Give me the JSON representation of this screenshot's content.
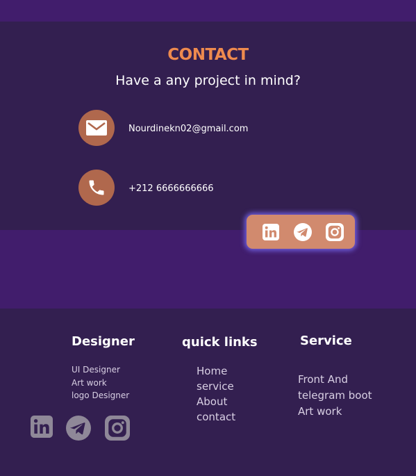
{
  "contact": {
    "title": "CONTACT",
    "subtitle": "Have a any project in  mind?",
    "email": "Nourdinekn02@gmail.com",
    "phone": "+212 6666666666",
    "icons": [
      "mail-icon",
      "phone-icon"
    ],
    "social_icons": [
      "linkedin-icon",
      "telegram-icon",
      "instagram-icon"
    ]
  },
  "footer": {
    "designer": {
      "heading": "Designer",
      "items": [
        "UI Designer",
        "Art work",
        "logo Designer"
      ]
    },
    "quick_links": {
      "heading": "quick links",
      "items": [
        "Home",
        "service",
        "About",
        "contact"
      ]
    },
    "service": {
      "heading": "Service",
      "items": [
        "Front And",
        "telegram boot",
        "Art work"
      ]
    },
    "social_icons": [
      "linkedin-icon",
      "telegram-icon",
      "instagram-icon"
    ]
  },
  "colors": {
    "accent": "#ee8a4e",
    "icon_bg": "#b0684d",
    "pill_bg": "#d18a6e",
    "glow": "#6d5cd8",
    "panel": "#331f50",
    "band": "#411d6c",
    "footer_icon": "#8f8898"
  }
}
